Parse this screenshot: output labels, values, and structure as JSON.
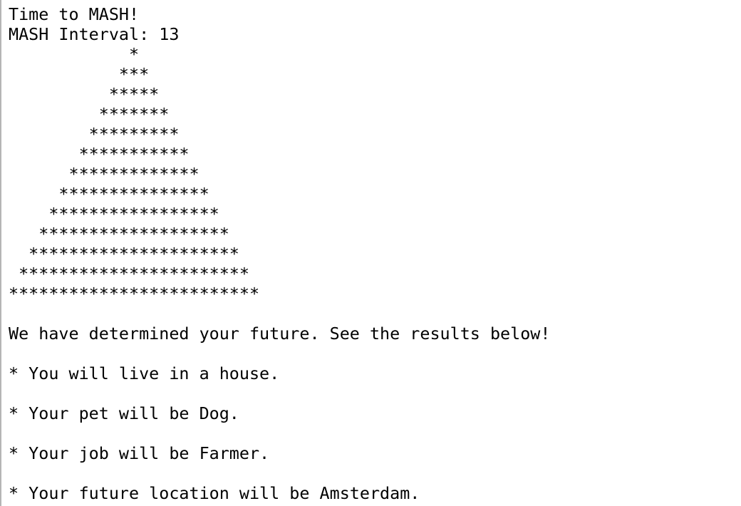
{
  "terminal": {
    "header": {
      "title_line": "Time to MASH!",
      "interval_line": "MASH Interval: 13"
    },
    "star_pyramid": [
      "            *",
      "           ***",
      "          *****",
      "         *******",
      "        *********",
      "       ***********",
      "      *************",
      "     ***************",
      "    *****************",
      "   *******************",
      "  *********************",
      " ***********************",
      "*************************"
    ],
    "summary_line": "We have determined your future. See the results below!",
    "results": [
      "* You will live in a house.",
      "* Your pet will be Dog.",
      "* Your job will be Farmer.",
      "* Your future location will be Amsterdam."
    ]
  }
}
